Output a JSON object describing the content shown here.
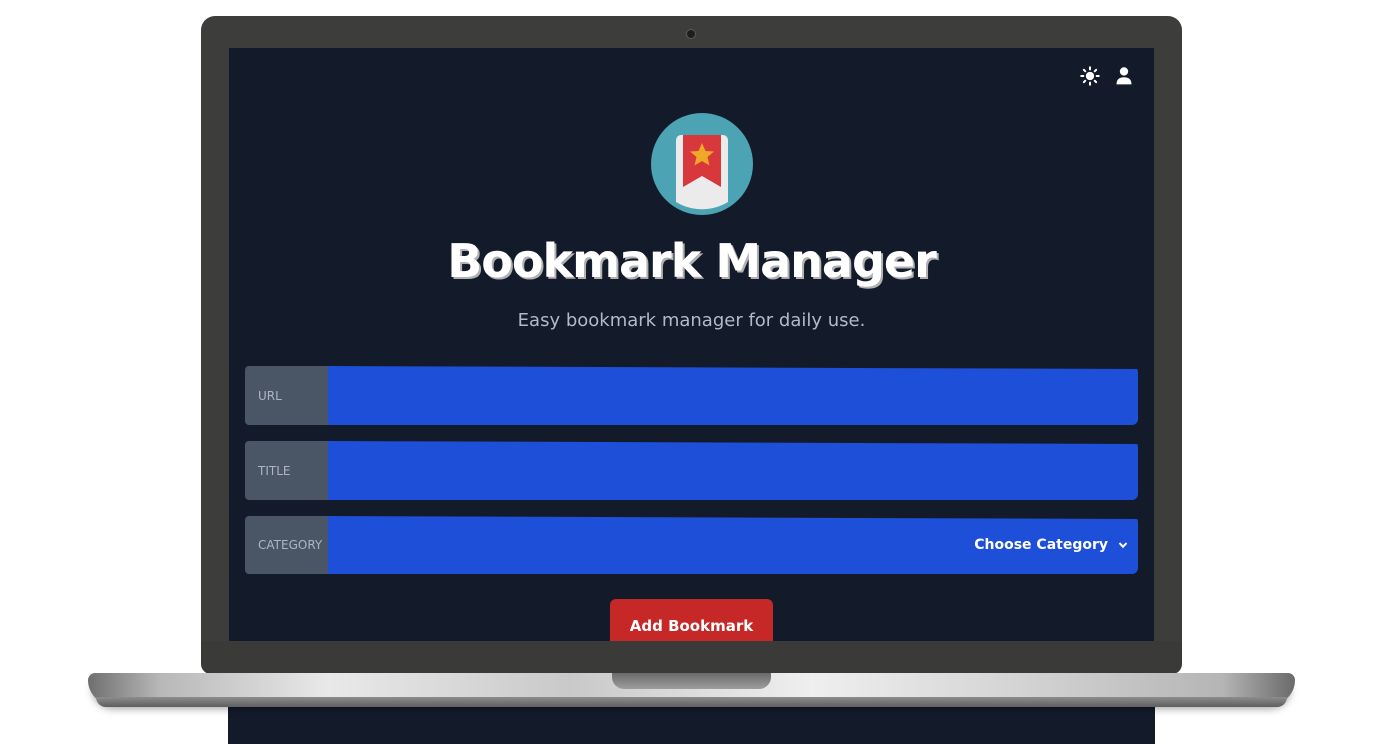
{
  "app": {
    "title": "Bookmark Manager",
    "subtitle": "Easy bookmark manager for daily use."
  },
  "header": {
    "icons": [
      "sun-icon",
      "user-icon"
    ]
  },
  "form": {
    "url": {
      "label": "URL",
      "value": ""
    },
    "title": {
      "label": "TITLE",
      "value": ""
    },
    "category": {
      "label": "CATEGORY",
      "selected": "Choose Category"
    },
    "submit_label": "Add Bookmark"
  },
  "colors": {
    "screen_bg": "#131a2a",
    "input_bg": "#1e4fd8",
    "label_bg": "#4a5566",
    "button_bg": "#c62828",
    "logo_circle": "#4ba3b3",
    "ribbon": "#d8373b",
    "star": "#f0a828"
  }
}
